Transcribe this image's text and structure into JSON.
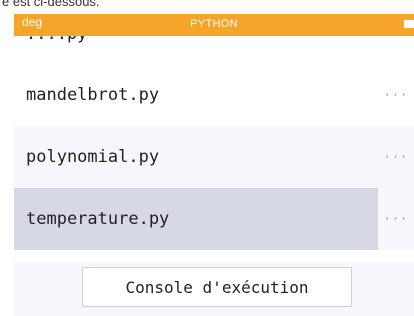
{
  "top_caption": "e est ci-dessous.",
  "status_bar": {
    "angle_mode": "deg",
    "title": "PYTHON",
    "battery_icon": "battery-icon",
    "color": "#f5a62a"
  },
  "clipped_item": "....py",
  "files": [
    {
      "name": "mandelbrot.py",
      "more": "···",
      "state": "normal"
    },
    {
      "name": "polynomial.py",
      "more": "···",
      "state": "normal"
    },
    {
      "name": "temperature.py",
      "more": "···",
      "state": "selected"
    }
  ],
  "footer": {
    "console_button": "Console d'exécution"
  },
  "colors": {
    "selected_row": "#d6d8e6",
    "tint": "#f5f7fc"
  }
}
